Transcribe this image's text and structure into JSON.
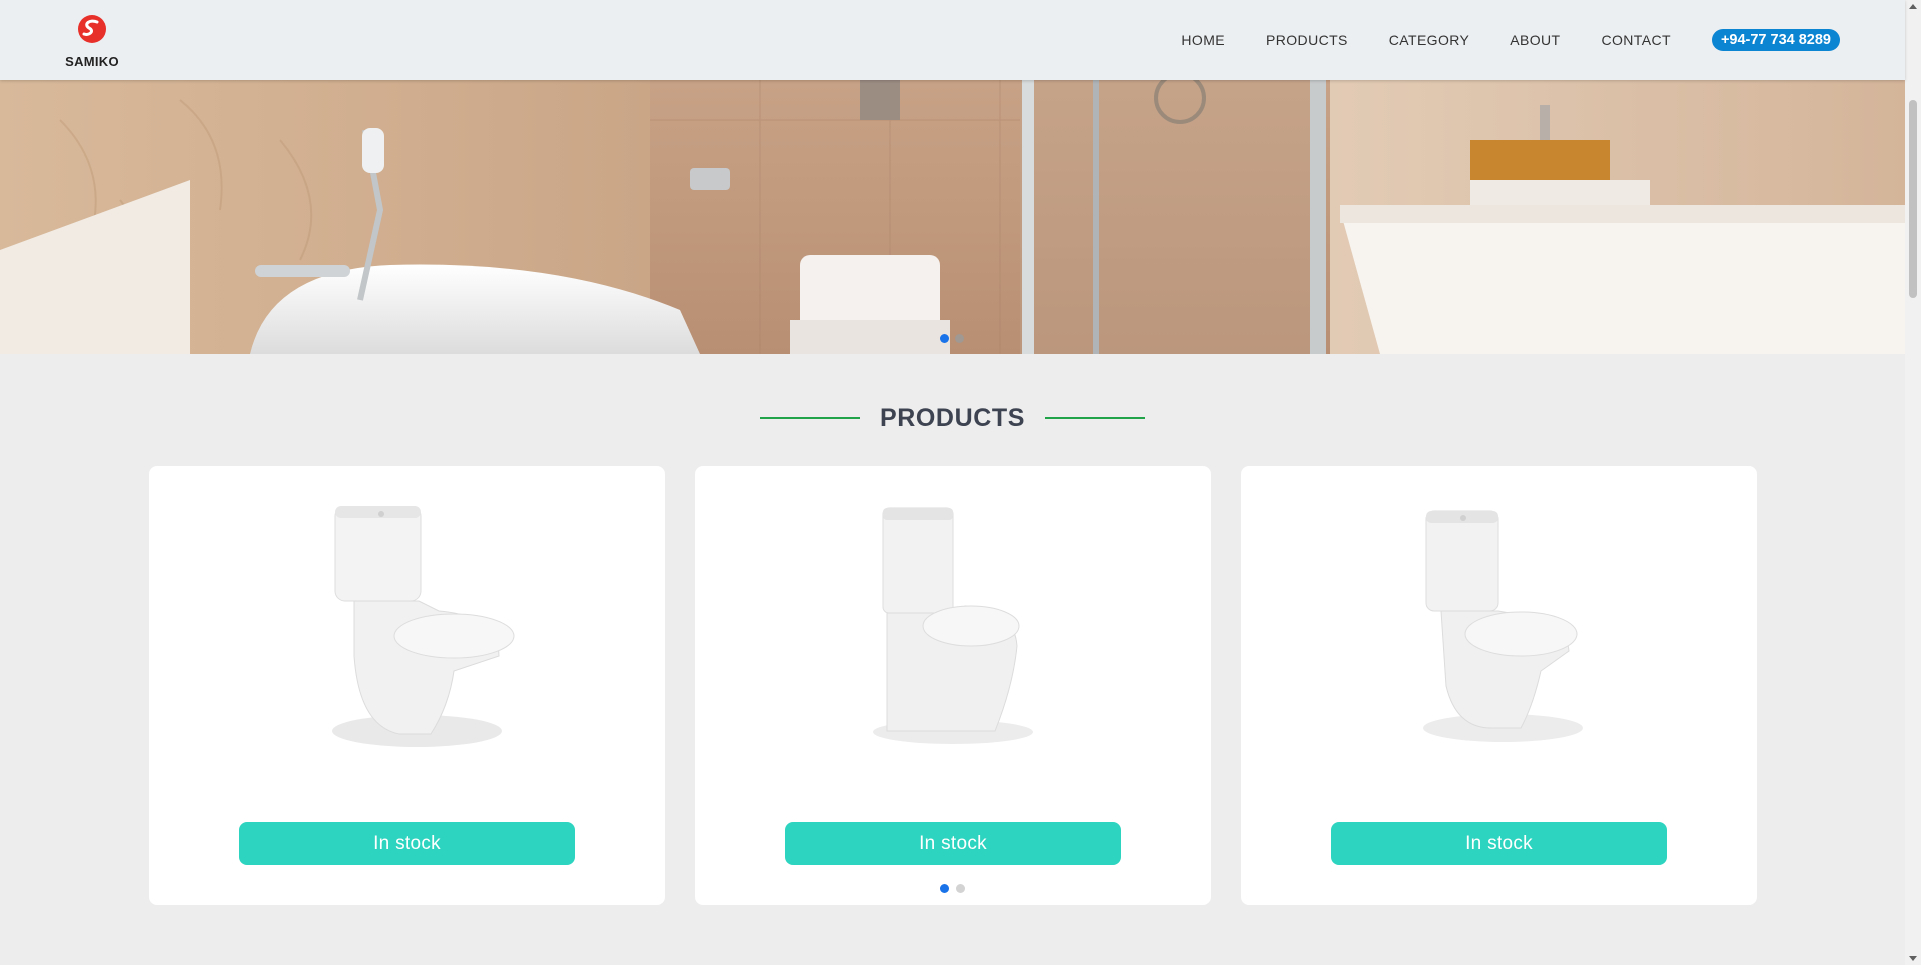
{
  "brand": {
    "name": "SAMIKO",
    "logo_icon": "samiko-s-logo-icon",
    "logo_color": "#e8302a"
  },
  "nav": {
    "items": [
      {
        "label": "HOME"
      },
      {
        "label": "PRODUCTS"
      },
      {
        "label": "CATEGORY"
      },
      {
        "label": "ABOUT"
      },
      {
        "label": "CONTACT"
      }
    ],
    "phone": "+94-77 734 8289"
  },
  "hero": {
    "image": "bathroom-banner-image",
    "slides": 2,
    "active_slide": 1
  },
  "products": {
    "title": "PRODUCTS",
    "accent_color": "#21a34a",
    "button_color": "#2dd4bf",
    "cards": [
      {
        "image": "toilet-image-1",
        "status": "In stock"
      },
      {
        "image": "toilet-image-2",
        "status": "In stock"
      },
      {
        "image": "toilet-image-3",
        "status": "In stock"
      }
    ],
    "carousel_pages": 2,
    "active_page": 1
  }
}
